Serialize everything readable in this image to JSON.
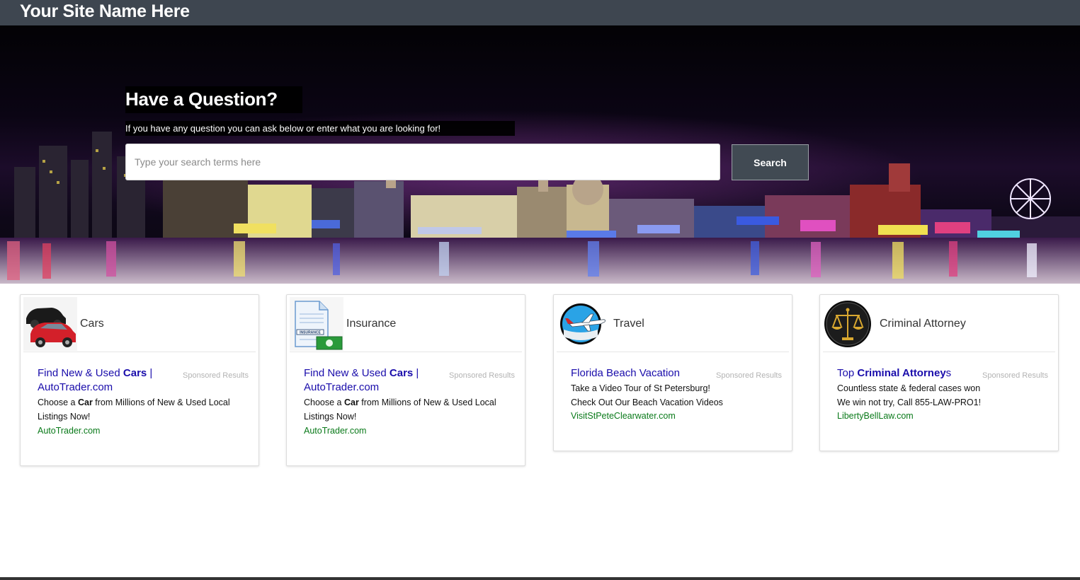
{
  "header": {
    "site_name": "Your Site Name Here"
  },
  "hero": {
    "title": "Have a Question?",
    "subtitle": "If you have any question you can ask below or enter what you are looking for!",
    "search_placeholder": "Type your search terms here",
    "search_button": "Search"
  },
  "colors": {
    "topbar": "#3e4650",
    "button": "#414a53",
    "ad_link": "#1a0dab",
    "ad_url": "#0a7a1a"
  },
  "cards": [
    {
      "title": "Cars",
      "icon": "cars-icon",
      "sponsored": "Sponsored Results",
      "ad_title_pre": "Find New & Used ",
      "ad_title_bold": "Cars",
      "ad_title_post": " | AutoTrader.com",
      "desc_pre": "Choose a ",
      "desc_bold": "Car",
      "desc_post": " from Millions of New & Used Local Listings Now!",
      "url": "AutoTrader.com"
    },
    {
      "title": "Insurance",
      "icon": "insurance-document-icon",
      "sponsored": "Sponsored Results",
      "ad_title_pre": "Find New & Used ",
      "ad_title_bold": "Cars",
      "ad_title_post": " | AutoTrader.com",
      "desc_pre": "Choose a ",
      "desc_bold": "Car",
      "desc_post": " from Millions of New & Used Local Listings Now!",
      "url": "AutoTrader.com"
    },
    {
      "title": "Travel",
      "icon": "airplane-icon",
      "sponsored": "Sponsored Results",
      "ad_title": "Florida Beach Vacation",
      "desc_line1": "Take a Video Tour of St Petersburg!",
      "desc_line2": "Check Out Our Beach Vacation Videos",
      "url": "VisitStPeteClearwater.com"
    },
    {
      "title": "Criminal Attorney",
      "icon": "scales-of-justice-icon",
      "sponsored": "Sponsored Results",
      "ad_title_pre": "Top ",
      "ad_title_bold": "Criminal Attorney",
      "ad_title_post": "s",
      "desc_line1": "Countless state & federal cases won",
      "desc_line2": "We win not try, Call 855-LAW-PRO1!",
      "url": "LibertyBellLaw.com"
    }
  ]
}
